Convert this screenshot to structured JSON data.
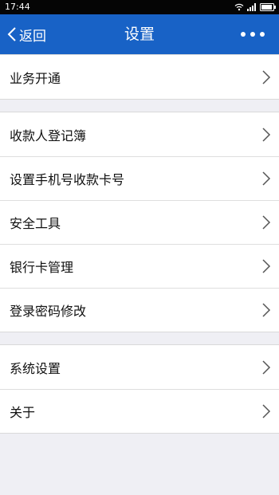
{
  "status_bar": {
    "time": "17:44",
    "icons": [
      "wifi-icon",
      "signal-icon",
      "battery-icon"
    ]
  },
  "nav": {
    "back_label": "返回",
    "title": "设置",
    "more_icon": "more-icon"
  },
  "colors": {
    "nav_background": "#1862c6",
    "page_background": "#efeff4",
    "status_bar": "#050505"
  },
  "groups": [
    {
      "items": [
        {
          "label": "业务开通"
        }
      ]
    },
    {
      "items": [
        {
          "label": "收款人登记簿"
        },
        {
          "label": "设置手机号收款卡号"
        },
        {
          "label": "安全工具"
        },
        {
          "label": "银行卡管理"
        },
        {
          "label": "登录密码修改"
        }
      ]
    },
    {
      "items": [
        {
          "label": "系统设置"
        },
        {
          "label": "关于"
        }
      ]
    }
  ]
}
